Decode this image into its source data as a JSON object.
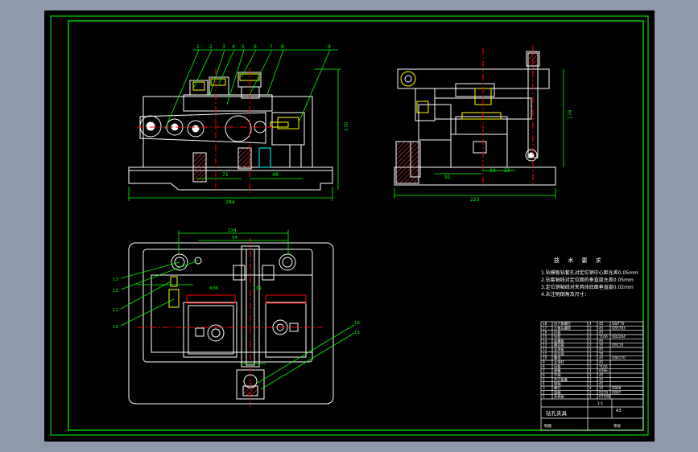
{
  "colors": {
    "viewport_bg": "#8e9aab",
    "paper": "#000000",
    "frame": "#00ff00",
    "geometry": "#ffffff",
    "dimension": "#00ff00",
    "highlight": "#ffff00",
    "section": "#ff0000",
    "hidden_line": "#00ffff",
    "hatch": "#ff4444"
  },
  "front_view": {
    "balloons": [
      "1",
      "2",
      "3",
      "4",
      "5",
      "6",
      "7",
      "8",
      "9"
    ],
    "dim_width": "284",
    "dim_height": "170",
    "dim_a": "71",
    "dim_b": "48"
  },
  "side_view": {
    "dim_width": "223",
    "dim_height": "174",
    "dim_a": "91",
    "dim_b": "23",
    "dim_c": "23"
  },
  "top_view": {
    "balloons_left": [
      "13",
      "12",
      "11",
      "10"
    ],
    "balloons_right": [
      "16",
      "15"
    ],
    "dim_outer": "134",
    "dim_inner": "54",
    "dim_center": "Φ36",
    "dim_vertical": "134"
  },
  "requirements": {
    "title": "技 术 要 求",
    "lines": [
      "1.钻模板钻套孔对定位销中心距允差0.05mm",
      "2.钻套轴线对定位面的垂直度允差0.05mm",
      "3.定位销轴线对夹具体底面垂直度0.02mm",
      "4.未注明倒角及尺寸："
    ]
  },
  "parts_table": {
    "rows": [
      [
        "18",
        "内六角螺钉",
        "4",
        "45",
        "GB/T70"
      ],
      [
        "17",
        "六角头螺栓",
        "2",
        "45",
        "GB5783"
      ],
      [
        "16",
        "压板",
        "1",
        "45",
        ""
      ],
      [
        "15",
        "钻套",
        "2",
        "T10A",
        "GB2264"
      ],
      [
        "14",
        "钻模板",
        "1",
        "45",
        ""
      ],
      [
        "13",
        "圆柱销",
        "2",
        "35",
        "GB119"
      ],
      [
        "12",
        "支承板",
        "1",
        "45",
        ""
      ],
      [
        "11",
        "定位销",
        "1",
        "T8",
        ""
      ],
      [
        "10",
        "螺母",
        "2",
        "45",
        "GB6170"
      ],
      [
        "9",
        "支承钉",
        "2",
        "45",
        ""
      ],
      [
        "8",
        "衬套",
        "1",
        "T10A",
        ""
      ],
      [
        "7",
        "弹簧",
        "1",
        "65Mn",
        ""
      ],
      [
        "6",
        "手柄",
        "1",
        "45",
        ""
      ],
      [
        "5",
        "开口垫圈",
        "1",
        "45",
        ""
      ],
      [
        "4",
        "销轴",
        "1",
        "45",
        ""
      ],
      [
        "3",
        "螺钉",
        "4",
        "35",
        "GB68"
      ],
      [
        "2",
        "垫圈",
        "2",
        "Q235",
        "GB97"
      ],
      [
        "1",
        "夹具体",
        "1",
        "HT200",
        ""
      ]
    ],
    "title": "钻孔夹具",
    "sheet": "A3",
    "scale": "1:1",
    "drawn": "制图",
    "checked": "审核"
  }
}
